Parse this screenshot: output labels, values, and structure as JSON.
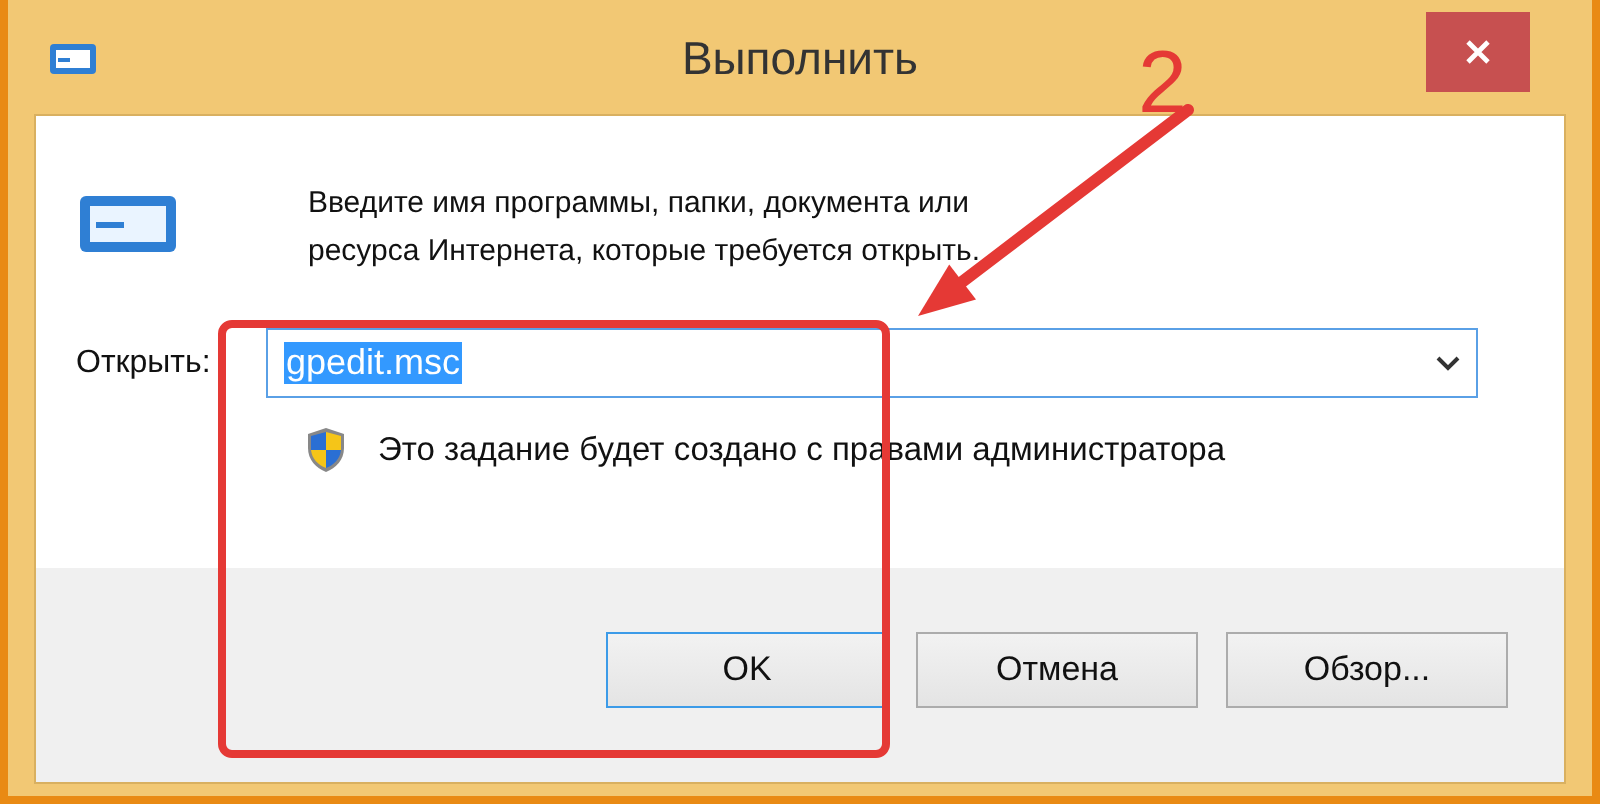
{
  "window": {
    "title": "Выполнить"
  },
  "description": "Введите имя программы, папки, документа или ресурса Интернета, которые требуется открыть.",
  "open_field": {
    "label": "Открыть:",
    "value": "gpedit.msc",
    "selected_text": true
  },
  "admin_note": "Это задание будет создано с правами администратора",
  "buttons": [
    {
      "label": "OK",
      "focused": true
    },
    {
      "label": "Отмена",
      "focused": false
    },
    {
      "label": "Обзор...",
      "focused": false
    }
  ],
  "annotation": {
    "step": "2"
  }
}
